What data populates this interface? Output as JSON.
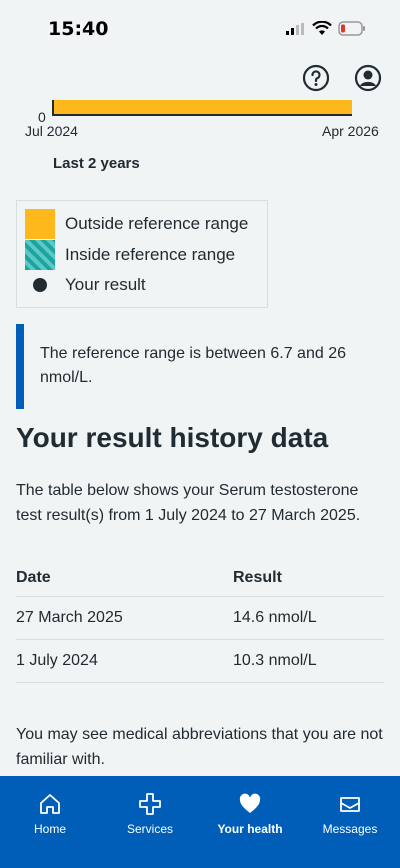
{
  "status": {
    "time": "15:40"
  },
  "chart": {
    "zero_label": "0",
    "x_start": "Jul 2024",
    "x_end": "Apr 2026",
    "period_label": "Last 2 years"
  },
  "chart_data": {
    "type": "bar",
    "x": [
      "Jul 2024",
      "Apr 2026"
    ],
    "y_min_label": "0",
    "bands": [
      {
        "name": "Outside reference range",
        "color": "#ffb81c"
      }
    ]
  },
  "legend": {
    "outside": "Outside reference range",
    "inside": "Inside reference range",
    "result": "Your result"
  },
  "callout": {
    "text": "The reference range is between 6.7 and 26 nmol/L."
  },
  "history": {
    "title": "Your result history data",
    "intro": "The table below shows your Serum testosterone test result(s) from 1 July 2024 to 27 March 2025.",
    "headers": {
      "date": "Date",
      "result": "Result"
    },
    "rows": [
      {
        "date": "27 March 2025",
        "result": "14.6 nmol/L"
      },
      {
        "date": "1 July 2024",
        "result": "10.3 nmol/L"
      }
    ]
  },
  "note": "You may see medical abbreviations that you are not familiar with.",
  "nav": {
    "home": "Home",
    "services": "Services",
    "your_health": "Your health",
    "messages": "Messages"
  },
  "colors": {
    "nhs_blue": "#005eb8",
    "warm_yellow": "#ffb81c",
    "text": "#212b32"
  }
}
